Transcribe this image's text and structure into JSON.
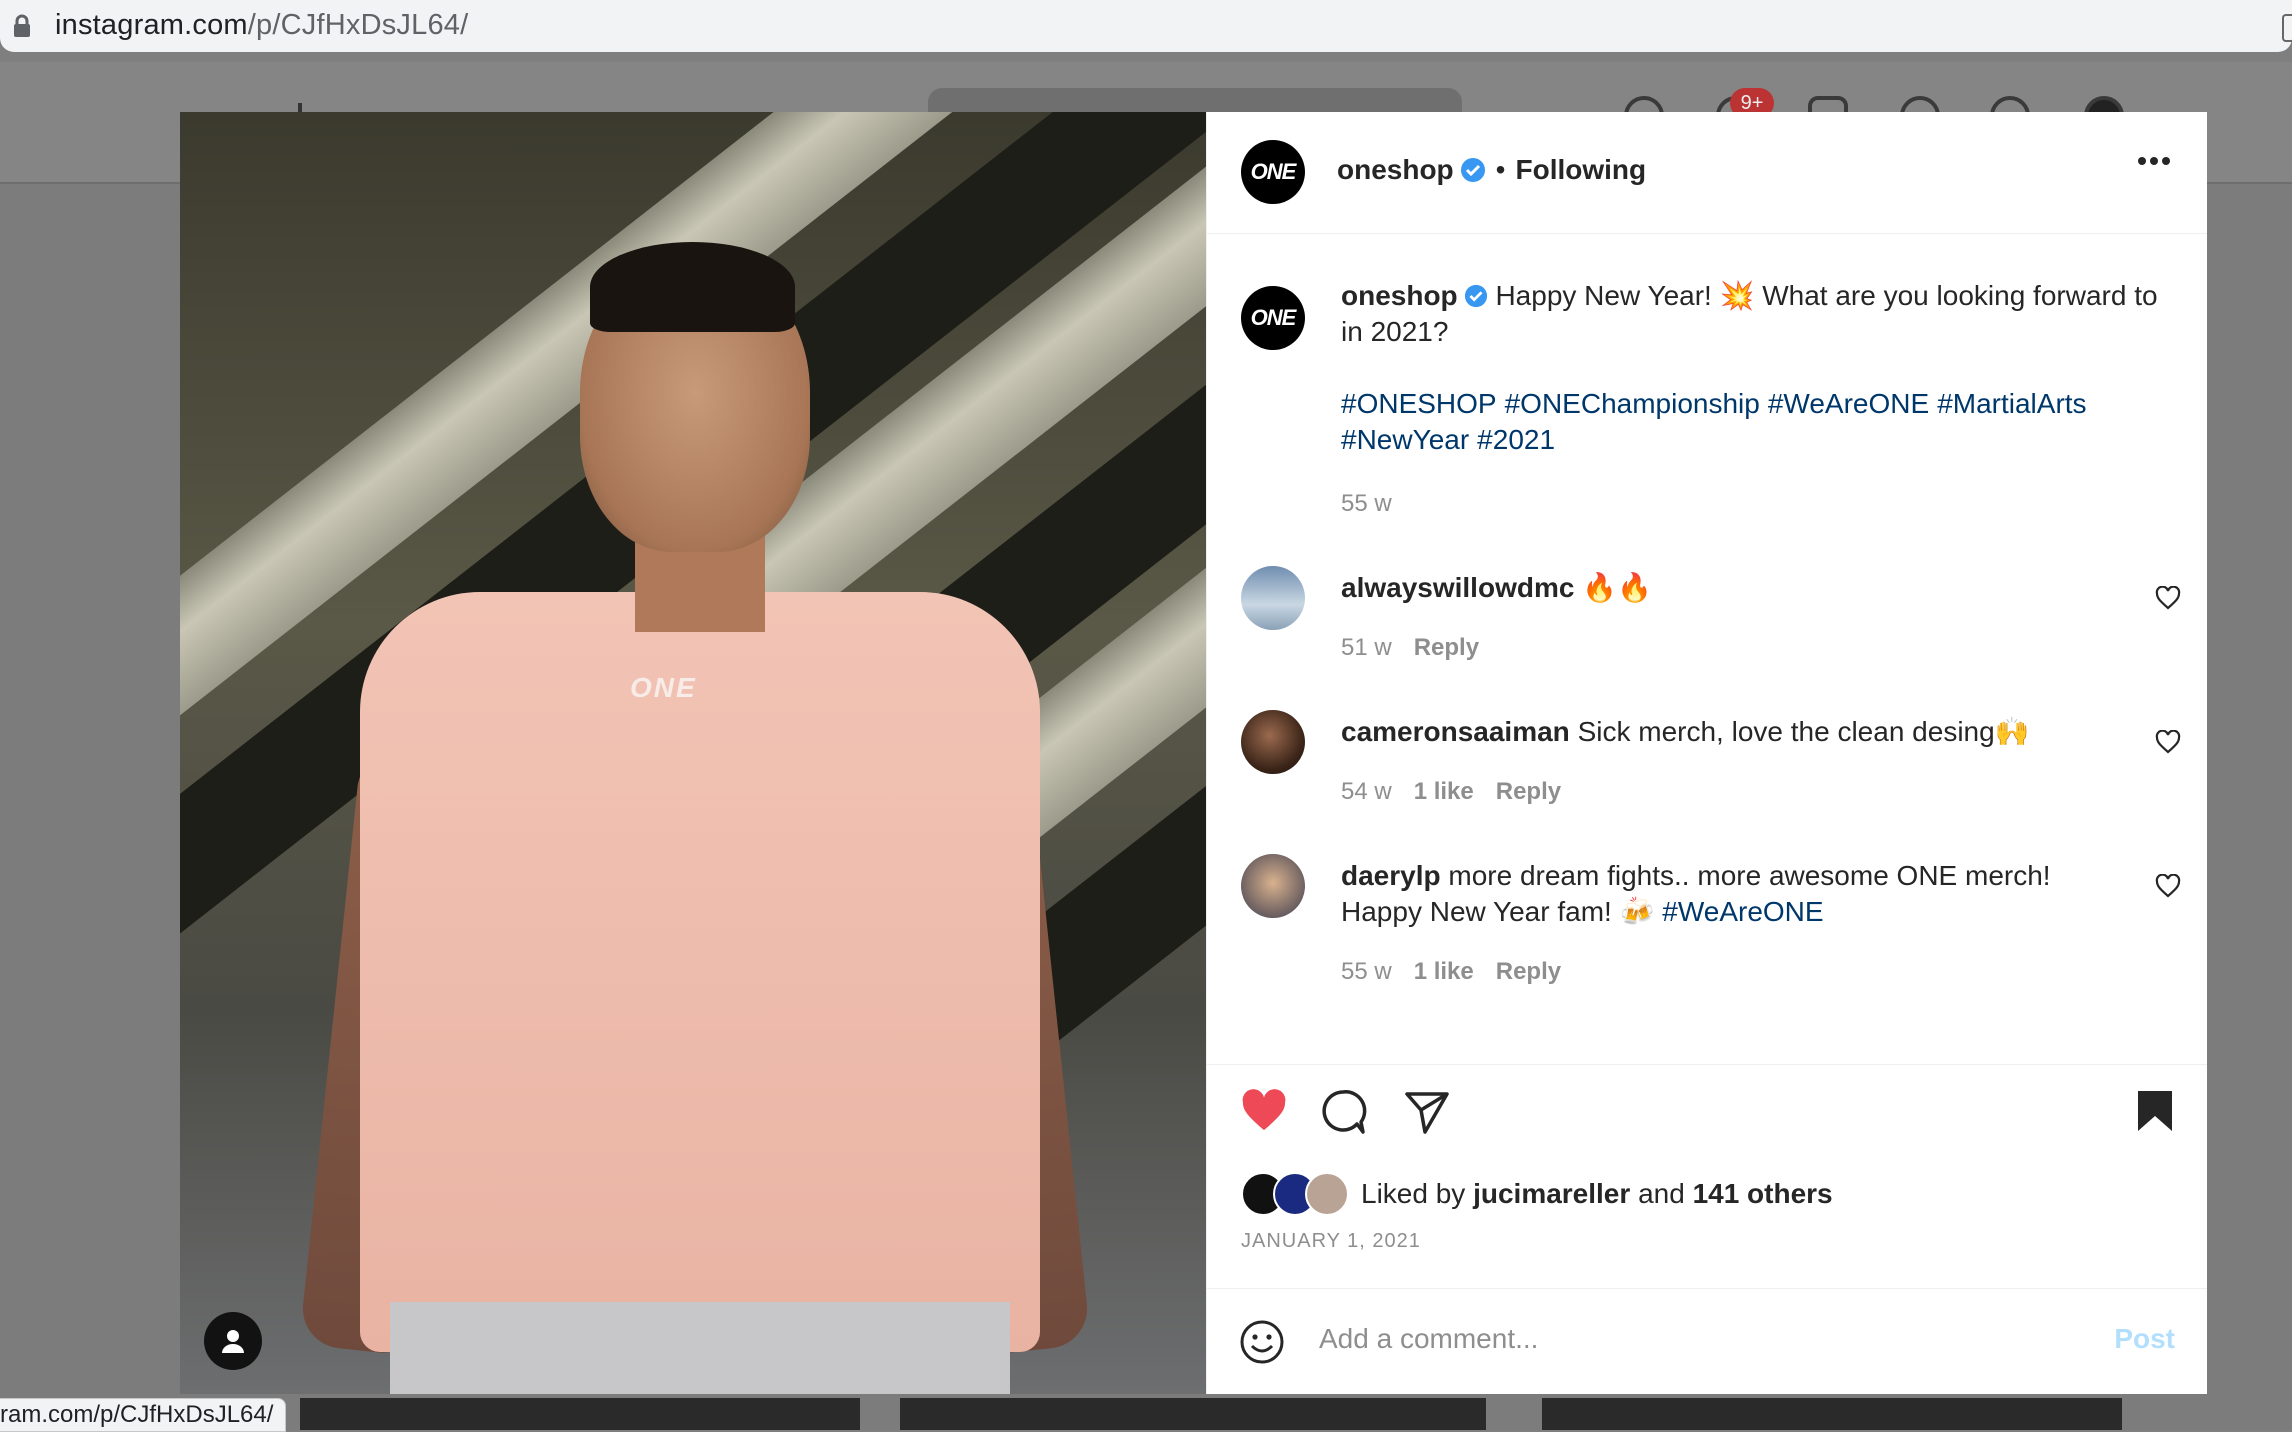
{
  "browser": {
    "url_domain": "instagram.com",
    "url_path": "/p/CJfHxDsJL64/",
    "status_url": "ram.com/p/CJfHxDsJL64/"
  },
  "background": {
    "notification_badge": "9+"
  },
  "post": {
    "header": {
      "username": "oneshop",
      "dot": "•",
      "follow_state": "Following",
      "avatar_text": "ONE"
    },
    "caption": {
      "username": "oneshop",
      "text": "Happy New Year! 💥 What are you looking forward to in 2021?",
      "hashtags": [
        "#ONESHOP",
        "#ONEChampionship",
        "#WeAreONE",
        "#MartialArts",
        "#NewYear",
        "#2021"
      ],
      "time": "55 w"
    },
    "comments": [
      {
        "username": "alwayswillowdmc",
        "text": "🔥🔥",
        "time": "51 w",
        "likes": "",
        "reply": "Reply"
      },
      {
        "username": "cameronsaaiman",
        "text": "Sick merch, love the clean desing🙌",
        "time": "54 w",
        "likes": "1 like",
        "reply": "Reply"
      },
      {
        "username": "daerylp",
        "text": "more dream fights.. more awesome ONE merch! Happy New Year fam! 🍻",
        "tag": "#WeAreONE",
        "time": "55 w",
        "likes": "1 like",
        "reply": "Reply"
      }
    ],
    "likes": {
      "prefix": "Liked by",
      "user": "jucimareller",
      "middle": "and",
      "others": "141 others"
    },
    "date": "JANUARY 1, 2021",
    "add_comment": {
      "placeholder": "Add a comment...",
      "post_label": "Post"
    },
    "photo_logo": "ONE",
    "colors": {
      "like_red": "#ed4956",
      "link_blue": "#00376b",
      "verified_blue": "#3897f0",
      "post_disabled": "#b2dffc"
    }
  }
}
